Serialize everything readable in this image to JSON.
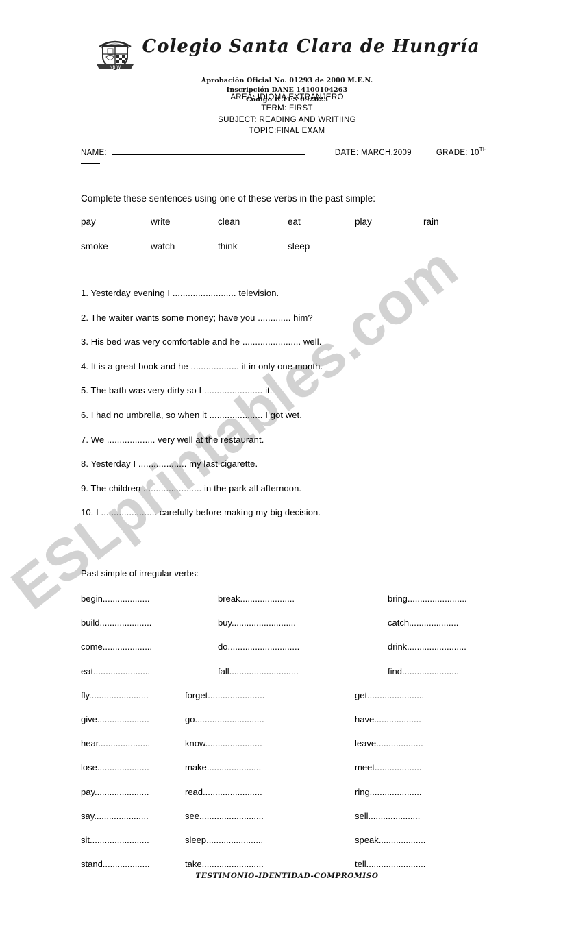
{
  "watermark": {
    "text": "ESLprintables.com",
    "color": "#c9c9c9"
  },
  "header": {
    "school_name": "Colegio Santa Clara de Hungría",
    "crest_motto": "NBIW",
    "approval_line1": "Aprobación Oficial No. 01293 de 2000 M.E.N.",
    "approval_line2": "Inscripción DANE 14100104263",
    "approval_line3": "Código ICFES 092023"
  },
  "exam_meta": {
    "area": "AREA: IDIOMA EXTRANJERO",
    "term": "TERM: FIRST",
    "subject": "SUBJECT: READING AND WRITIING",
    "topic": "TOPIC:FINAL EXAM"
  },
  "id_line": {
    "name_label": "NAME:",
    "date_label": "DATE:",
    "date_value": "MARCH,2009",
    "grade_label": "GRADE:",
    "grade_value": "10",
    "grade_suffix": "TH"
  },
  "section1": {
    "instruction": "Complete these sentences using one of these verbs in the past simple:",
    "verb_bank_row1": [
      "pay",
      "write",
      "clean",
      "eat",
      "play",
      "rain"
    ],
    "verb_bank_row2": [
      "smoke",
      "watch",
      "think",
      "sleep"
    ],
    "sentences": [
      "1. Yesterday evening I ......................... television.",
      "2. The waiter wants some money; have you .............  him?",
      "3. His bed was very comfortable and he ....................... well.",
      "4. It is a great book and he ................... it in only one month.",
      "5. The bath was very dirty so I ....................... it.",
      "6. I had no umbrella, so when it ..................... I got wet.",
      "7. We ...................  very well at the restaurant.",
      "8. Yesterday I ................... my last cigarette.",
      "9. The children ....................... in the park all afternoon.",
      "10. I ...................... carefully before making my big decision."
    ]
  },
  "section2": {
    "title": "Past simple of irregular verbs:",
    "rows": [
      [
        "begin...................",
        "break......................",
        "bring........................"
      ],
      [
        "build.....................",
        "buy..........................",
        "catch...................."
      ],
      [
        "come....................",
        "do.............................",
        "drink........................"
      ],
      [
        "eat.......................",
        "fall............................",
        "find......................."
      ],
      [
        "fly........................",
        "forget.......................",
        "get......................."
      ],
      [
        "give.....................",
        "go............................",
        "have..................."
      ],
      [
        "hear.....................",
        "know.......................",
        "leave..................."
      ],
      [
        "lose.....................",
        "make......................",
        "meet..................."
      ],
      [
        "pay......................",
        "read........................",
        "ring....................."
      ],
      [
        "say......................",
        "see..........................",
        "sell....................."
      ],
      [
        "sit........................",
        "sleep.......................",
        "speak..................."
      ],
      [
        "stand...................",
        "take.........................",
        "tell........................"
      ]
    ]
  },
  "footer": {
    "motto": "TESTIMONIO-IDENTIDAD-COMPROMISO"
  }
}
